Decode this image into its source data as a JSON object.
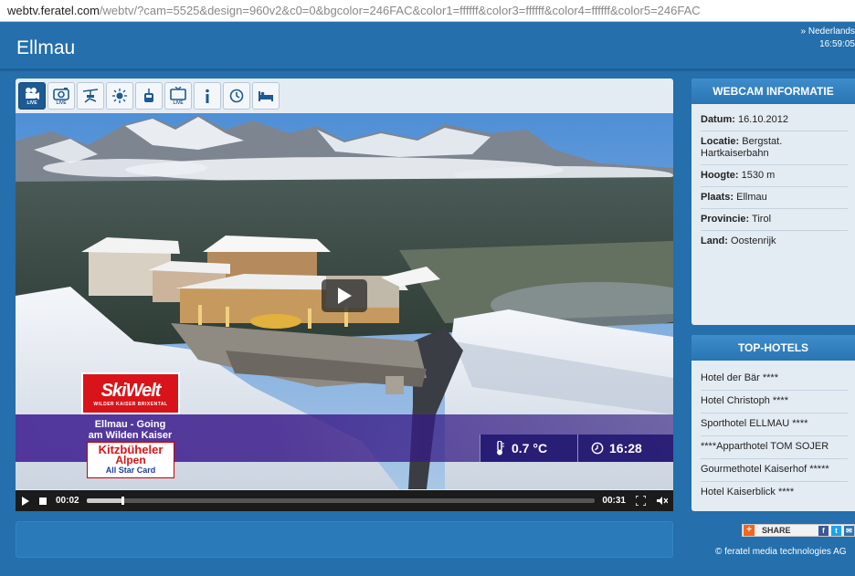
{
  "browser": {
    "url_host": "webtv.feratel.com",
    "url_path": "/webtv/?cam=5525&design=960v2&c0=0&bgcolor=246FAC&color1=ffffff&color3=ffffff&color4=ffffff&color5=246FAC"
  },
  "header": {
    "title": "Ellmau",
    "language": "» Nederlands",
    "clock": "16:59:05"
  },
  "toolbar": {
    "buttons": [
      {
        "icon": "video-camera-live-icon",
        "badge": "LIVE",
        "active": true
      },
      {
        "icon": "photo-camera-live-icon",
        "badge": "LIVE",
        "active": false
      },
      {
        "icon": "ski-lift-icon",
        "badge": "",
        "active": false
      },
      {
        "icon": "sun-weather-icon",
        "badge": "",
        "active": false
      },
      {
        "icon": "cable-car-icon",
        "badge": "",
        "active": false
      },
      {
        "icon": "tv-live-icon",
        "badge": "LIVE",
        "active": false
      },
      {
        "icon": "info-icon",
        "badge": "",
        "active": false
      },
      {
        "icon": "history-clock-icon",
        "badge": "",
        "active": false
      },
      {
        "icon": "bed-icon",
        "badge": "",
        "active": false
      }
    ]
  },
  "video": {
    "brand_logo": "SkiWelt",
    "brand_sub": "WILDER KAISER BRIXENTAL",
    "location_line1": "Ellmau - Going",
    "location_line2": "am Wilden Kaiser",
    "sponsor_line1": "Kitzbüheler",
    "sponsor_line2": "Alpen",
    "sponsor_line3": "All Star Card",
    "temperature": "0.7 °C",
    "time": "16:28",
    "elapsed": "00:02",
    "duration": "00:31",
    "progress_fraction": 0.07
  },
  "webcam_info": {
    "heading": "WEBCAM INFORMATIE",
    "rows": [
      {
        "label": "Datum:",
        "value": " 16.10.2012"
      },
      {
        "label": "Locatie:",
        "value": " Bergstat. Hartkaiserbahn"
      },
      {
        "label": "Hoogte:",
        "value": " 1530 m"
      },
      {
        "label": "Plaats:",
        "value": " Ellmau"
      },
      {
        "label": "Provincie:",
        "value": " Tirol"
      },
      {
        "label": "Land:",
        "value": " Oostenrijk"
      }
    ]
  },
  "top_hotels": {
    "heading": "TOP-HOTELS",
    "items": [
      "Hotel der Bär ****",
      "Hotel Christoph ****",
      "Sporthotel ELLMAU ****",
      "****Apparthotel TOM SOJER",
      "Gourmethotel Kaiserhof *****",
      "Hotel Kaiserblick ****"
    ]
  },
  "share": {
    "label": "SHARE"
  },
  "footer": {
    "copyright": "© feratel media technologies AG"
  },
  "colors": {
    "background": "#246FAC",
    "panel": "#e4ecf3",
    "accent": "#1d5a93"
  }
}
